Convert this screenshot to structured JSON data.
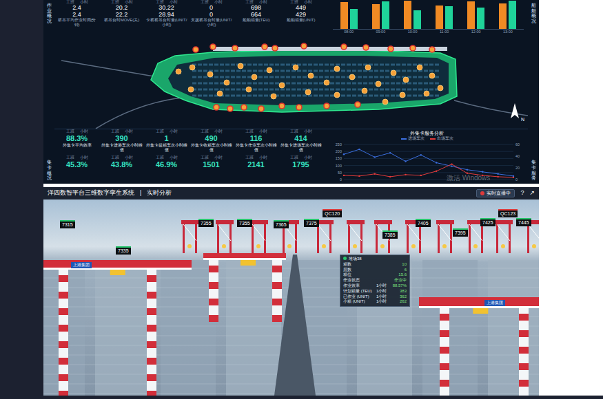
{
  "dashboard": {
    "side_labels": [
      {
        "text": "作业概况"
      },
      {
        "text": "集卡概况"
      },
      {
        "text": "船舶概况"
      },
      {
        "text": "集卡服务"
      }
    ],
    "top_stats": [
      {
        "tags": [
          "工班",
          "小时"
        ],
        "values": [
          "2.4",
          "2.4"
        ],
        "label": "桥吊平均作业时间(分钟)"
      },
      {
        "tags": [
          "工班",
          "小时"
        ],
        "values": [
          "20.2",
          "22.2"
        ],
        "label": "桥吊台时MOVE(关)"
      },
      {
        "tags": [
          "工班",
          "小时"
        ],
        "values": [
          "30.22",
          "28.94"
        ],
        "label": "卡桥桥吊台时量(UNIT/小时)"
      },
      {
        "tags": [
          "工班",
          "小时"
        ],
        "values": [
          "0",
          "0"
        ],
        "label": "支援桥吊台时量(UNIT/小时)"
      },
      {
        "tags": [
          "工班",
          "小时"
        ],
        "values": [
          "698",
          "664"
        ],
        "label": "船舶箱量(TEU)"
      },
      {
        "tags": [
          "工班",
          "小时"
        ],
        "values": [
          "449",
          "429"
        ],
        "label": "船舶箱量(UNIT)"
      }
    ],
    "bar_chart": {
      "max": 100,
      "labels": [
        "08:00",
        "09:00",
        "10:00",
        "11:00",
        "12:00",
        "13:00"
      ],
      "series": [
        {
          "color": "#f08a24",
          "values": [
            92,
            85,
            98,
            80,
            95,
            88
          ]
        },
        {
          "color": "#1fd39a",
          "values": [
            70,
            96,
            65,
            78,
            74,
            97
          ]
        }
      ]
    },
    "map": {
      "north": "N"
    },
    "bottom_stats": [
      {
        "tags": [
          "工班",
          "小时"
        ],
        "value": "88.3%",
        "label": "外集卡平均效率"
      },
      {
        "tags": [
          "工班",
          "小时"
        ],
        "value": "390",
        "label": "外集卡进港车次小时峰值"
      },
      {
        "tags": [
          "工班",
          "小时"
        ],
        "value": "1",
        "label": "外集卡提箱车次小时峰值"
      },
      {
        "tags": [
          "工班",
          "小时"
        ],
        "value": "490",
        "label": "外集卡收箱车次小时峰值"
      },
      {
        "tags": [
          "工班",
          "小时"
        ],
        "value": "116",
        "label": "外集卡作业车次小时峰值"
      },
      {
        "tags": [
          "工班",
          "小时"
        ],
        "value": "414",
        "label": "外集卡进场车次小时峰值"
      }
    ],
    "bottom_stats_2": [
      {
        "tags": [
          "工班",
          "小时"
        ],
        "value": "45.3%"
      },
      {
        "tags": [
          "工班",
          "小时"
        ],
        "value": "43.8%"
      },
      {
        "tags": [
          "工班",
          "小时"
        ],
        "value": "46.9%"
      },
      {
        "tags": [
          "工班",
          "小时"
        ],
        "value": "1501"
      },
      {
        "tags": [
          "工班",
          "小时"
        ],
        "value": "2141"
      },
      {
        "tags": [
          "工班",
          "小时"
        ],
        "value": "1795"
      }
    ],
    "line_chart": {
      "title": "外集卡服务分析",
      "legend": [
        {
          "text": "进场车次",
          "color": "#3b6fe0"
        },
        {
          "text": "出场车次",
          "color": "#e23b3b"
        }
      ],
      "y_ticks": [
        "250",
        "200",
        "150",
        "100",
        "50",
        "0"
      ],
      "y2_ticks": [
        "60",
        "40",
        "20",
        "0"
      ],
      "y_max": 250,
      "series": [
        {
          "color": "#3b6fe0",
          "values": [
            180,
            215,
            160,
            190,
            130,
            175,
            120,
            95,
            70,
            55,
            40,
            25
          ]
        },
        {
          "color": "#e23b3b",
          "values": [
            30,
            25,
            40,
            20,
            35,
            30,
            60,
            110,
            45,
            30,
            20,
            15
          ]
        }
      ]
    },
    "watermark": "激活 Windows"
  },
  "twin": {
    "title": "洋四数智平台三维数字孪生系统",
    "separator": "|",
    "subtitle": "实时分析",
    "live_button": "实时直播中",
    "help": "?",
    "expand": "↗",
    "cranes": [
      {
        "label": "7315",
        "color": "#27c46b"
      },
      {
        "label": "7355",
        "color": "#27c46b"
      },
      {
        "label": "7355",
        "color": "#27c46b"
      },
      {
        "label": "7365",
        "color": "#27c46b"
      },
      {
        "label": "7375",
        "color": "#27c46b"
      },
      {
        "label": "QC120",
        "color": "#e03a3a"
      },
      {
        "label": "7385",
        "color": "#27c46b"
      },
      {
        "label": "7405",
        "color": "#27c46b"
      },
      {
        "label": "7395",
        "color": "#27c46b"
      },
      {
        "label": "7425",
        "color": "#27c46b"
      },
      {
        "label": "QC123",
        "color": "#e03a3a"
      },
      {
        "label": "7445",
        "color": "#27c46b"
      },
      {
        "label": "7335",
        "color": "#27c46b"
      }
    ],
    "logos": [
      "上港集团",
      "上港集团"
    ],
    "tooltip": {
      "title": "堆场38",
      "rows": [
        {
          "label": "箱数",
          "value": "10"
        },
        {
          "label": "层数",
          "value": "6"
        },
        {
          "label": "箱位",
          "value": "15.6"
        },
        {
          "label": "作业状态",
          "value": "作业中"
        },
        {
          "label": "作业效率",
          "period": "1小时",
          "value": "88.57%"
        },
        {
          "label": "计划箱量 (TEU)",
          "period": "1小时",
          "value": "383"
        },
        {
          "label": "已作业 (UNIT)",
          "period": "1小时",
          "value": "362"
        },
        {
          "label": "小箱 (UNIT)",
          "period": "1小时",
          "value": "262"
        }
      ]
    }
  }
}
